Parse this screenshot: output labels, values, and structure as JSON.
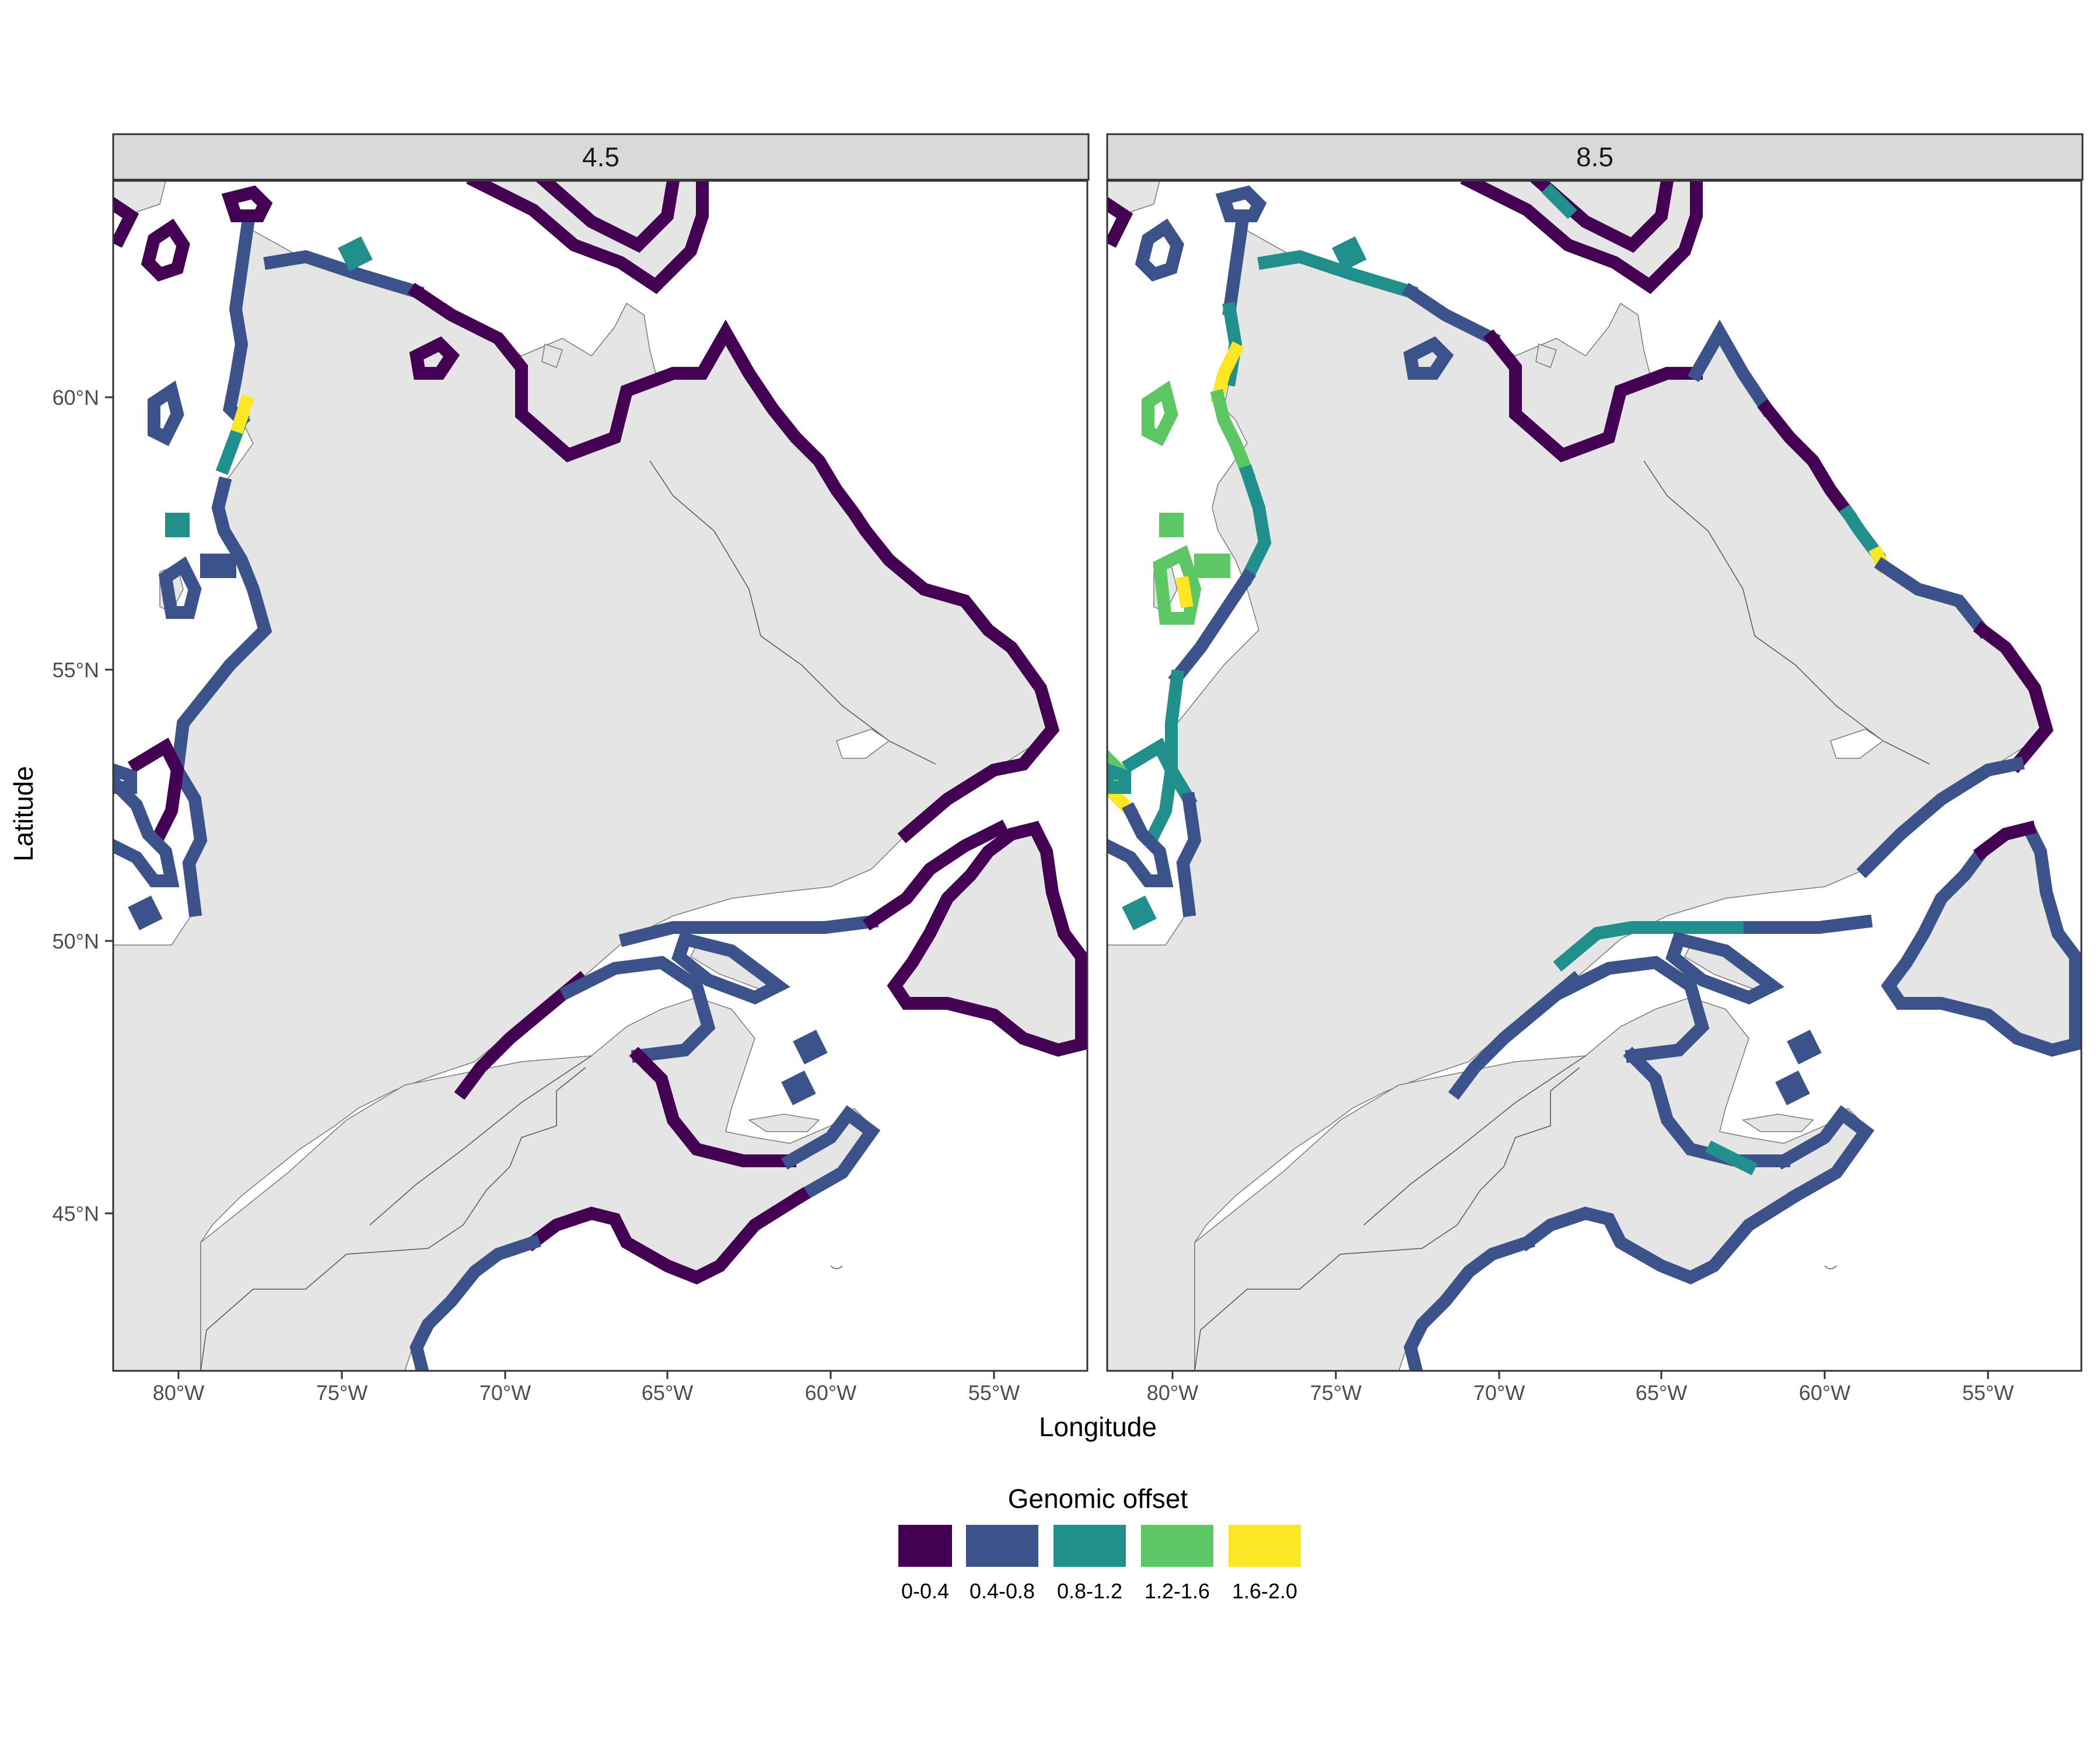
{
  "facets": [
    {
      "label": "4.5",
      "id": "rcp45"
    },
    {
      "label": "8.5",
      "id": "rcp85"
    }
  ],
  "axes": {
    "x_title": "Longitude",
    "y_title": "Latitude",
    "x_ticks": [
      "80°W",
      "75°W",
      "70°W",
      "65°W",
      "60°W",
      "55°W"
    ],
    "y_ticks": [
      "45°N",
      "50°N",
      "55°N",
      "60°N"
    ],
    "x_tick_values": [
      -80,
      -75,
      -70,
      -65,
      -60,
      -55
    ],
    "y_tick_values": [
      45,
      50,
      55,
      60
    ],
    "xlim": [
      -82,
      -52.5
    ],
    "ylim": [
      42,
      64
    ]
  },
  "legend": {
    "title": "Genomic offset",
    "items": [
      {
        "label": "0-0.4",
        "color": "#440154"
      },
      {
        "label": "0.4-0.8",
        "color": "#3b528b"
      },
      {
        "label": "0.8-1.2",
        "color": "#21908c"
      },
      {
        "label": "1.2-1.6",
        "color": "#5dc863"
      },
      {
        "label": "1.6-2.0",
        "color": "#fde725"
      }
    ]
  },
  "colors": {
    "panel_border": "#333333",
    "strip_fill": "#d9d9d9",
    "land": "#e5e5e5",
    "water": "#ffffff"
  }
}
